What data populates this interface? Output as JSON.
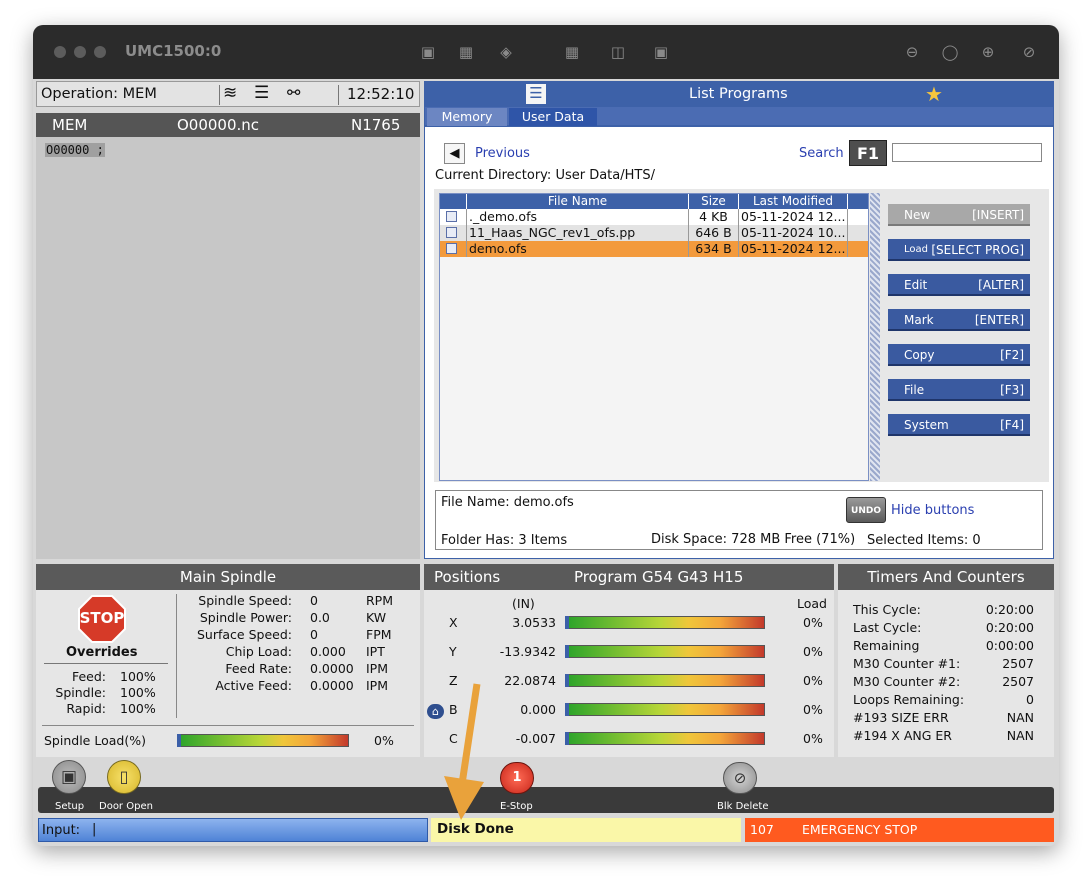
{
  "window": {
    "title": "UMC1500:0"
  },
  "toolbar_icons": [
    "pointer-icon",
    "image-icon",
    "layers-icon",
    "grid-icon",
    "split-view-icon",
    "panel-icon",
    "zoom-out-icon",
    "zoom-reset-icon",
    "zoom-in-icon",
    "zoom-fit-icon"
  ],
  "status": {
    "operation": "Operation: MEM",
    "time": "12:52:10"
  },
  "program": {
    "mode": "MEM",
    "name": "O00000.nc",
    "line": "N1765",
    "code": "O00000 ;"
  },
  "list_programs": {
    "title": "List Programs",
    "tabs": [
      "Memory",
      "User Data"
    ],
    "previous": "Previous",
    "search_label": "Search",
    "search_key": "F1",
    "search_value": "",
    "current_dir": "Current Directory: User Data/HTS/",
    "columns": [
      "File Name",
      "Size",
      "Last Modified"
    ],
    "rows": [
      {
        "name": "._demo.ofs",
        "size": "4 KB",
        "modified": "05-11-2024 12..."
      },
      {
        "name": "11_Haas_NGC_rev1_ofs.pp",
        "size": "646 B",
        "modified": "05-11-2024 10..."
      },
      {
        "name": "demo.ofs",
        "size": "634 B",
        "modified": "05-11-2024 12..."
      }
    ],
    "buttons": [
      {
        "label": "New",
        "key": "[INSERT]"
      },
      {
        "label": "Load",
        "key": "[SELECT PROG]"
      },
      {
        "label": "Edit",
        "key": "[ALTER]"
      },
      {
        "label": "Mark",
        "key": "[ENTER]"
      },
      {
        "label": "Copy",
        "key": "[F2]"
      },
      {
        "label": "File",
        "key": "[F3]"
      },
      {
        "label": "System",
        "key": "[F4]"
      }
    ],
    "file_name": "File Name: demo.ofs",
    "undo": "UNDO",
    "hide_buttons": "Hide buttons",
    "folder_has": "Folder Has: 3 Items",
    "disk_space": "Disk Space: 728 MB Free (71%)",
    "selected": "Selected Items: 0"
  },
  "spindle": {
    "title": "Main Spindle",
    "stop": "STOP",
    "overrides": "Overrides",
    "override_rows": [
      {
        "label": "Feed:",
        "value": "100%"
      },
      {
        "label": "Spindle:",
        "value": "100%"
      },
      {
        "label": "Rapid:",
        "value": "100%"
      }
    ],
    "stats": [
      {
        "label": "Spindle Speed:",
        "value": "0",
        "unit": "RPM"
      },
      {
        "label": "Spindle Power:",
        "value": "0.0",
        "unit": "KW"
      },
      {
        "label": "Surface Speed:",
        "value": "0",
        "unit": "FPM"
      },
      {
        "label": "Chip Load:",
        "value": "0.000",
        "unit": "IPT"
      },
      {
        "label": "Feed Rate:",
        "value": "0.0000",
        "unit": "IPM"
      },
      {
        "label": "Active Feed:",
        "value": "0.0000",
        "unit": "IPM"
      }
    ],
    "load_label": "Spindle Load(%)",
    "load_value": "0%",
    "load_fraction": 0
  },
  "positions": {
    "title": "Positions",
    "program": "Program G54 G43 H15",
    "unit": "(IN)",
    "load_header": "Load",
    "axes": [
      {
        "axis": "X",
        "value": "3.0533",
        "load": "0%"
      },
      {
        "axis": "Y",
        "value": "-13.9342",
        "load": "0%"
      },
      {
        "axis": "Z",
        "value": "22.0874",
        "load": "0%"
      },
      {
        "axis": "B",
        "value": "0.000",
        "load": "0%"
      },
      {
        "axis": "C",
        "value": "-0.007",
        "load": "0%"
      }
    ]
  },
  "timers": {
    "title": "Timers And Counters",
    "rows": [
      {
        "label": "This Cycle:",
        "value": "0:20:00"
      },
      {
        "label": "Last Cycle:",
        "value": "0:20:00"
      },
      {
        "label": "Remaining",
        "value": "0:00:00"
      },
      {
        "label": "M30 Counter #1:",
        "value": "2507"
      },
      {
        "label": "M30 Counter #2:",
        "value": "2507"
      },
      {
        "label": "Loops Remaining:",
        "value": "0"
      },
      {
        "label": "#193 SIZE ERR",
        "value": "NAN"
      },
      {
        "label": "#194 X ANG ER",
        "value": "NAN"
      }
    ]
  },
  "bottom_icons": {
    "setup": "Setup",
    "door": "Door Open",
    "estop": "E-Stop",
    "blk": "Blk Delete",
    "estop_badge": "1"
  },
  "statusbar": {
    "input_label": "Input:",
    "input_value": "|",
    "message": "Disk Done",
    "alarm_code": "107",
    "alarm_text": "EMERGENCY STOP"
  },
  "colors": {
    "accent_blue": "#3d61a8",
    "highlight_orange": "#f39a3c",
    "alarm_orange": "#ff5a1f",
    "arrow": "#e9a23b"
  }
}
